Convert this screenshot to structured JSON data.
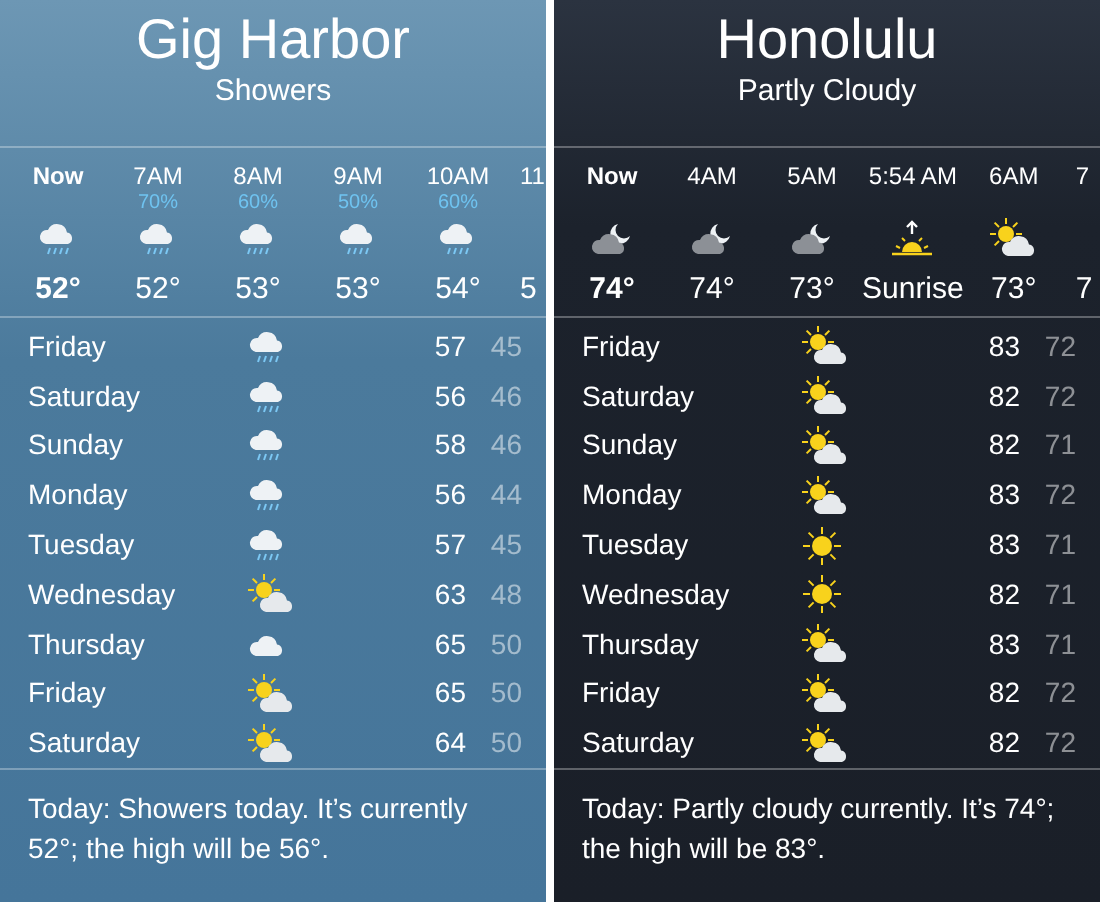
{
  "cities": [
    {
      "name": "Gig Harbor",
      "condition": "Showers",
      "kind": "rain",
      "hourly": [
        {
          "time": "Now",
          "now": true,
          "kind": "rain",
          "temp": "52°"
        },
        {
          "time": "7AM",
          "now": false,
          "precip": "70%",
          "kind": "rain",
          "temp": "52°"
        },
        {
          "time": "8AM",
          "now": false,
          "precip": "60%",
          "kind": "rain",
          "temp": "53°"
        },
        {
          "time": "9AM",
          "now": false,
          "precip": "50%",
          "kind": "rain",
          "temp": "53°"
        },
        {
          "time": "10AM",
          "now": false,
          "precip": "60%",
          "kind": "rain",
          "temp": "54°"
        },
        {
          "time": "11",
          "now": false,
          "temp": "5"
        }
      ],
      "daily": [
        {
          "day": "Friday",
          "kind": "rain",
          "high": "57",
          "low": "45"
        },
        {
          "day": "Saturday",
          "kind": "rain",
          "high": "56",
          "low": "46"
        },
        {
          "day": "Sunday",
          "kind": "rain",
          "high": "58",
          "low": "46"
        },
        {
          "day": "Monday",
          "kind": "rain",
          "high": "56",
          "low": "44"
        },
        {
          "day": "Tuesday",
          "kind": "rain",
          "high": "57",
          "low": "45"
        },
        {
          "day": "Wednesday",
          "kind": "partly-sunny",
          "high": "63",
          "low": "48"
        },
        {
          "day": "Thursday",
          "kind": "cloud",
          "high": "65",
          "low": "50"
        },
        {
          "day": "Friday",
          "kind": "partly-sunny",
          "high": "65",
          "low": "50"
        },
        {
          "day": "Saturday",
          "kind": "partly-sunny",
          "high": "64",
          "low": "50"
        }
      ],
      "summary": "Today: Showers today. It’s currently 52°; the high will be 56°."
    },
    {
      "name": "Honolulu",
      "condition": "Partly Cloudy",
      "kind": "night",
      "hourly": [
        {
          "time": "Now",
          "now": true,
          "kind": "night-cloud",
          "temp": "74°"
        },
        {
          "time": "4AM",
          "now": false,
          "kind": "night-cloud",
          "temp": "74°"
        },
        {
          "time": "5AM",
          "now": false,
          "kind": "night-cloud",
          "temp": "73°"
        },
        {
          "time": "5:54 AM",
          "now": false,
          "kind": "sunrise",
          "temp": "Sunrise"
        },
        {
          "time": "6AM",
          "now": false,
          "kind": "partly-sunny",
          "temp": "73°"
        },
        {
          "time": "7",
          "now": false,
          "temp": "7"
        }
      ],
      "daily": [
        {
          "day": "Friday",
          "kind": "partly-sunny",
          "high": "83",
          "low": "72"
        },
        {
          "day": "Saturday",
          "kind": "partly-sunny",
          "high": "82",
          "low": "72"
        },
        {
          "day": "Sunday",
          "kind": "partly-sunny",
          "high": "82",
          "low": "71"
        },
        {
          "day": "Monday",
          "kind": "partly-sunny",
          "high": "83",
          "low": "72"
        },
        {
          "day": "Tuesday",
          "kind": "sun",
          "high": "83",
          "low": "71"
        },
        {
          "day": "Wednesday",
          "kind": "sun",
          "high": "82",
          "low": "71"
        },
        {
          "day": "Thursday",
          "kind": "partly-sunny",
          "high": "83",
          "low": "71"
        },
        {
          "day": "Friday",
          "kind": "partly-sunny",
          "high": "82",
          "low": "72"
        },
        {
          "day": "Saturday",
          "kind": "partly-sunny",
          "high": "82",
          "low": "72"
        }
      ],
      "summary": "Today: Partly cloudy currently. It’s 74°; the high will be 83°."
    }
  ]
}
